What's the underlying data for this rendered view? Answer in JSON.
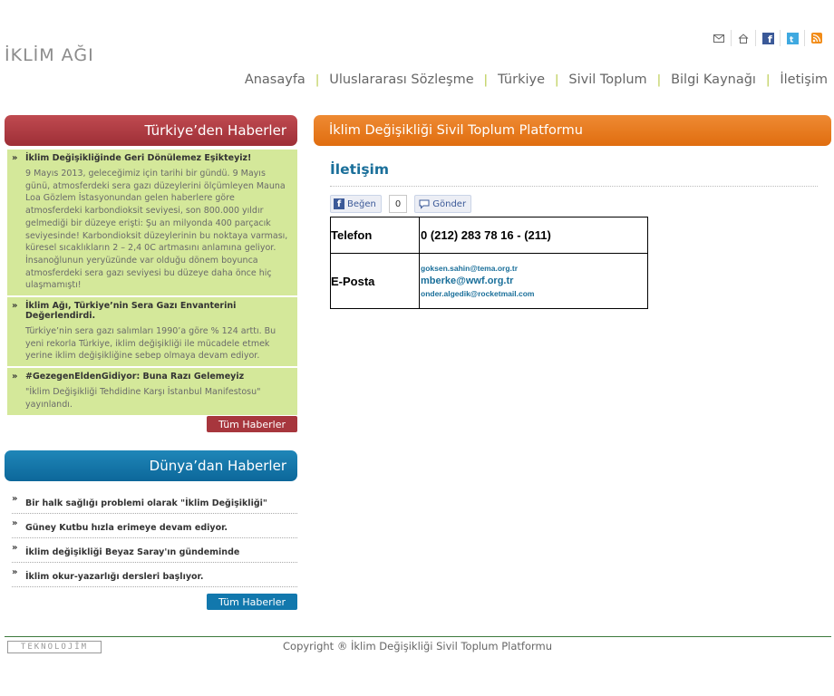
{
  "site": {
    "logo": "İKLİM AĞI"
  },
  "top_icons": [
    "mail-icon",
    "home-icon",
    "facebook-icon",
    "twitter-icon",
    "rss-icon"
  ],
  "nav": [
    {
      "label": "Anasayfa"
    },
    {
      "label": "Uluslararası Sözleşme"
    },
    {
      "label": "Türkiye"
    },
    {
      "label": "Sivil Toplum"
    },
    {
      "label": "Bilgi Kaynağı"
    },
    {
      "label": "İletişim"
    }
  ],
  "turkey_news": {
    "heading": "Türkiye’den Haberler",
    "items": [
      {
        "title": "İklim Değişikliğinde Geri Dönülemez Eşikteyiz!",
        "body": "9 Mayıs 2013, geleceğimiz için tarihi bir gündü. 9 Mayıs günü, atmosferdeki sera gazı düzeylerini ölçümleyen Mauna Loa Gözlem İstasyonundan gelen haberlere göre atmosferdeki karbondioksit seviyesi, son 800.000 yıldır gelmediği bir düzeye erişti: Şu an milyonda 400 parçacık seviyesinde! Karbondioksit düzeylerinin bu noktaya varması, küresel sıcaklıkların 2 – 2,4 0C artmasını anlamına geliyor. İnsanoğlunun yeryüzünde var olduğu dönem boyunca atmosferdeki sera gazı seviyesi bu düzeye daha önce hiç ulaşmamıştı!"
      },
      {
        "title": "İklim Ağı, Türkiye’nin Sera Gazı Envanterini Değerlendirdi.",
        "body": "Türkiye’nin sera gazı salımları 1990’a göre % 124 arttı. Bu yeni rekorla Türkiye, iklim değişikliği ile mücadele etmek yerine iklim değişikliğine sebep olmaya devam ediyor."
      },
      {
        "title": "#GezegenEldenGidiyor: Buna Razı Gelemeyiz",
        "body": "\"İklim Değişikliği Tehdidine Karşı İstanbul Manifestosu\" yayınlandı."
      }
    ],
    "all_button": "Tüm Haberler"
  },
  "world_news": {
    "heading": "Dünya’dan Haberler",
    "items": [
      {
        "title": "Bir halk sağlığı problemi olarak \"İklim Değişikliği\""
      },
      {
        "title": "Güney Kutbu hızla erimeye devam ediyor."
      },
      {
        "title": "İklim değişikliği Beyaz Saray'ın gündeminde"
      },
      {
        "title": "İklim okur-yazarlığı dersleri başlıyor."
      }
    ],
    "all_button": "Tüm Haberler"
  },
  "main": {
    "heading": "İklim Değişikliği Sivil Toplum Platformu",
    "page_title": "İletişim",
    "social": {
      "like_label": "Beğen",
      "like_count": "0",
      "send_label": "Gönder"
    },
    "contact": {
      "phone_label": "Telefon",
      "phone_value": "0 (212) 283 78 16 -  (211)",
      "email_label": "E-Posta",
      "emails": [
        "goksen.sahin@tema.org.tr",
        "mberke@wwf.org.tr",
        "onder.algedik@rocketmail.com"
      ]
    }
  },
  "footer": {
    "brand": "TEKNOLOJİM",
    "copyright": "Copyright ® İklim Değişikliği Sivil Toplum Platformu"
  },
  "colors": {
    "red": "#a7363d",
    "blue": "#1278ad",
    "orange": "#e67a1f",
    "green_bg": "#d4e89a",
    "nav_sep": "#b5c944"
  }
}
